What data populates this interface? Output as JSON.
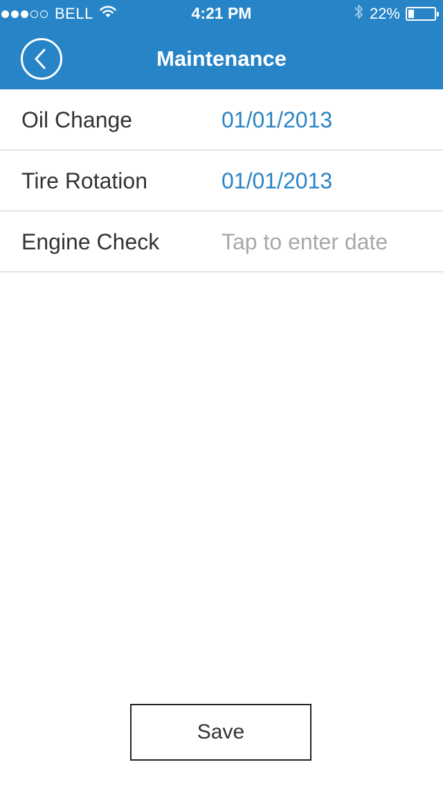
{
  "status_bar": {
    "signal_bars_filled": 3,
    "signal_bars_total": 5,
    "carrier": "BELL",
    "wifi_icon": "wifi-icon",
    "time": "4:21 PM",
    "bluetooth_icon": "bluetooth-icon",
    "battery_percent": "22%",
    "battery_level": 0.22
  },
  "nav": {
    "title": "Maintenance",
    "back_icon": "chevron-left-icon"
  },
  "items": [
    {
      "label": "Oil Change",
      "value": "01/01/2013",
      "is_placeholder": false
    },
    {
      "label": "Tire Rotation",
      "value": "01/01/2013",
      "is_placeholder": false
    },
    {
      "label": "Engine Check",
      "value": "Tap to enter date",
      "is_placeholder": true
    }
  ],
  "save_label": "Save",
  "colors": {
    "header": "#2784c7",
    "date_value": "#2a84c4",
    "placeholder": "#a8a8a8",
    "divider": "#c9c9c9"
  }
}
